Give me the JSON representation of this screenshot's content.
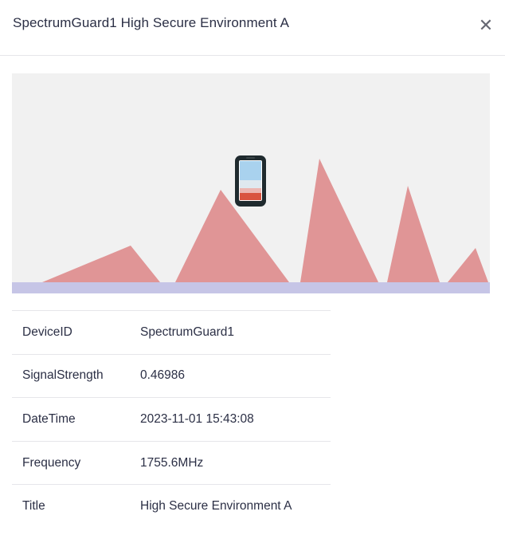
{
  "header": {
    "title": "SpectrumGuard1 High Secure Environment A",
    "close_icon": "close-icon"
  },
  "visualization": {
    "device_icon": "smartphone-icon",
    "peak_color": "#e09596",
    "baseline_color": "#c6c5e6",
    "background_color": "#f1f1f1"
  },
  "details": {
    "rows": [
      {
        "key": "DeviceID",
        "value": "SpectrumGuard1"
      },
      {
        "key": "SignalStrength",
        "value": "0.46986"
      },
      {
        "key": "DateTime",
        "value": "2023-11-01 15:43:08"
      },
      {
        "key": "Frequency",
        "value": "1755.6MHz"
      },
      {
        "key": "Title",
        "value": "High Secure Environment A"
      }
    ]
  }
}
